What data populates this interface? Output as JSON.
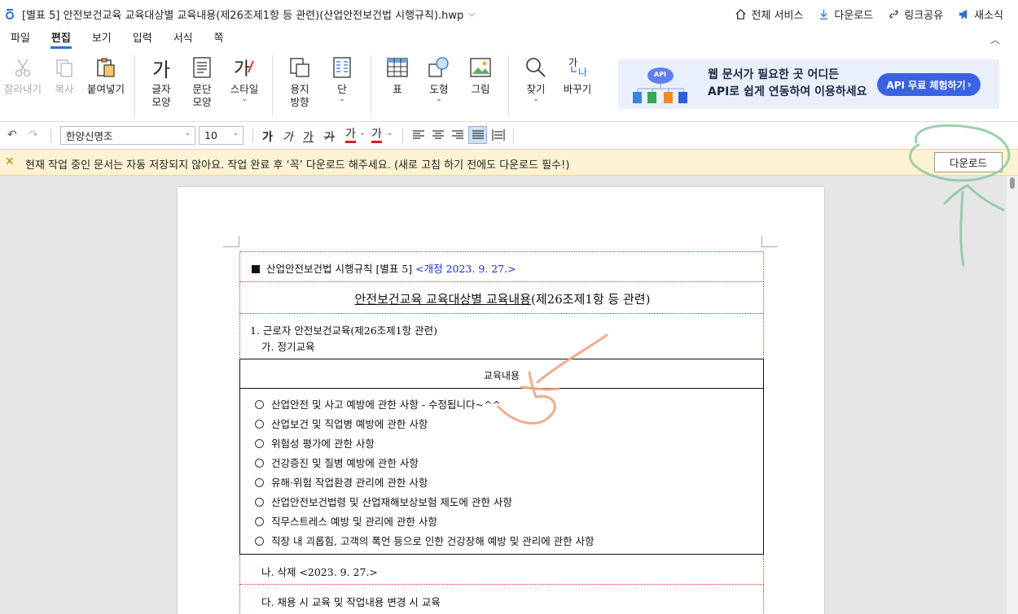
{
  "titlebar": {
    "title": "[별표 5] 안전보건교육 교육대상별 교육내용(제26조제1항 등 관련)(산업안전보건법 시행규칙).hwp",
    "links": [
      {
        "label": "전체 서비스",
        "icon": "home-icon"
      },
      {
        "label": "다운로드",
        "icon": "download-icon"
      },
      {
        "label": "링크공유",
        "icon": "link-icon"
      },
      {
        "label": "새소식",
        "icon": "megaphone-icon"
      }
    ]
  },
  "menu": {
    "tabs": [
      "파일",
      "편집",
      "보기",
      "입력",
      "서식",
      "쪽"
    ],
    "active": "편집"
  },
  "ribbon": {
    "cut": "잘라내기",
    "copy": "복사",
    "paste": "붙여넣기",
    "char_shape_1": "글자",
    "char_shape_2": "모양",
    "para_shape_1": "문단",
    "para_shape_2": "모양",
    "style": "스타일",
    "paper_1": "용지",
    "paper_2": "방향",
    "columns": "단",
    "table": "표",
    "shape": "도형",
    "picture": "그림",
    "find": "찾기",
    "replace": "바꾸기",
    "char_glyph": "가",
    "style_glyph": "가",
    "replace_glyph_1": "가",
    "replace_glyph_2": "나"
  },
  "banner": {
    "line1": "웹 문서가 필요한 곳 어디든",
    "line2": "API로 쉽게 연동하여 이용하세요",
    "button": "API 무료 체험하기 ",
    "cloud_label": "API"
  },
  "format": {
    "font": "한양신명조",
    "size": "10",
    "bold": "가",
    "italic": "가",
    "underline": "가",
    "strike": "가",
    "color": "가",
    "highlight": "가"
  },
  "notice": {
    "text": "현재 작업 중인 문서는 자동 저장되지 않아요. 작업 완료 후 ‘꼭’ 다운로드 해주세요. (새로 고침 하기 전에도 다운로드 필수!)",
    "button": "다운로드"
  },
  "document": {
    "header_prefix": "산업안전보건법 시행규칙 [별표 5]",
    "header_revision": "<개정 2023. 9. 27.>",
    "title_underlined": "안전보건교육 교육대상별 교육내용",
    "title_rest": "(제26조제1항 등 관련)",
    "section1": "1. 근로자 안전보건교육(제26조제1항 관련)",
    "section1_ga": "가. 정기교육",
    "table_header": "교육내용",
    "items": [
      "산업안전 및 사고 예방에 관한 사항  - 수정됩니다~^^",
      "산업보건 및 직업병 예방에 관한 사항",
      "위험성 평가에 관한 사항",
      "건강증진 및 질병 예방에 관한 사항",
      "유해·위험 작업환경 관리에 관한 사항",
      "산업안전보건법령 및 산업재해보상보험 제도에 관한 사항",
      "직무스트레스 예방 및 관리에 관한 사항",
      "직장 내 괴롭힘, 고객의 폭언 등으로 인한 건강장해 예방 및 관리에 관한 사항"
    ],
    "section1_na": "나. 삭제 <2023. 9. 27.>",
    "section1_da": "다. 채용 시 교육 및 작업내용 변경 시 교육"
  },
  "colors": {
    "accent": "#2a6fd6",
    "banner_bg": "#e9f0fb",
    "banner_button": "#3b63e0",
    "notice_bg": "#fdf3d3",
    "revision_blue": "#1a2ad6",
    "annotation_orange": "#f4a27a",
    "annotation_green": "#8cc7a0"
  }
}
